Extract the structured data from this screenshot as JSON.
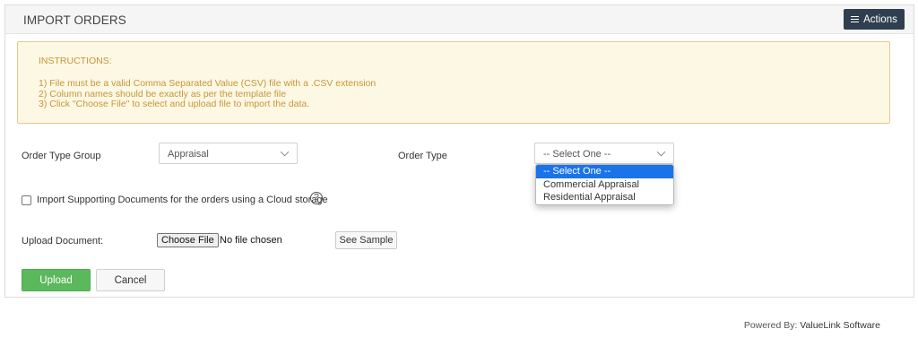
{
  "header": {
    "title": "IMPORT ORDERS",
    "actions_label": "Actions"
  },
  "instructions": {
    "title": "INSTRUCTIONS:",
    "lines": [
      "1) File must be a valid Comma Separated Value (CSV) file with a .CSV extension",
      "2) Column names should be exactly as per the template file",
      "3) Click \"Choose File\" to select and upload file to import the data."
    ]
  },
  "form": {
    "order_type_group": {
      "label": "Order Type Group",
      "value": "Appraisal"
    },
    "order_type": {
      "label": "Order Type",
      "value": "-- Select One --",
      "options": [
        "-- Select One --",
        "Commercial Appraisal",
        "Residential Appraisal"
      ],
      "selected_index": 0
    },
    "cloud_checkbox": {
      "label": "Import Supporting Documents for the orders using a Cloud storage",
      "checked": false,
      "help_icon": "question-circle-icon"
    },
    "upload_document": {
      "label": "Upload Document:",
      "choose_label": "Choose File",
      "status": "No file chosen",
      "sample_label": "See Sample"
    }
  },
  "buttons": {
    "upload": "Upload",
    "cancel": "Cancel"
  },
  "footer": {
    "prefix": "Powered By: ",
    "brand": "ValueLink Software"
  },
  "colors": {
    "accent_dark": "#2f3f4f",
    "success": "#5cb85c",
    "warning_bg": "#fcf8e3",
    "warning_text": "#c8953b",
    "select_highlight": "#1a73e8"
  }
}
